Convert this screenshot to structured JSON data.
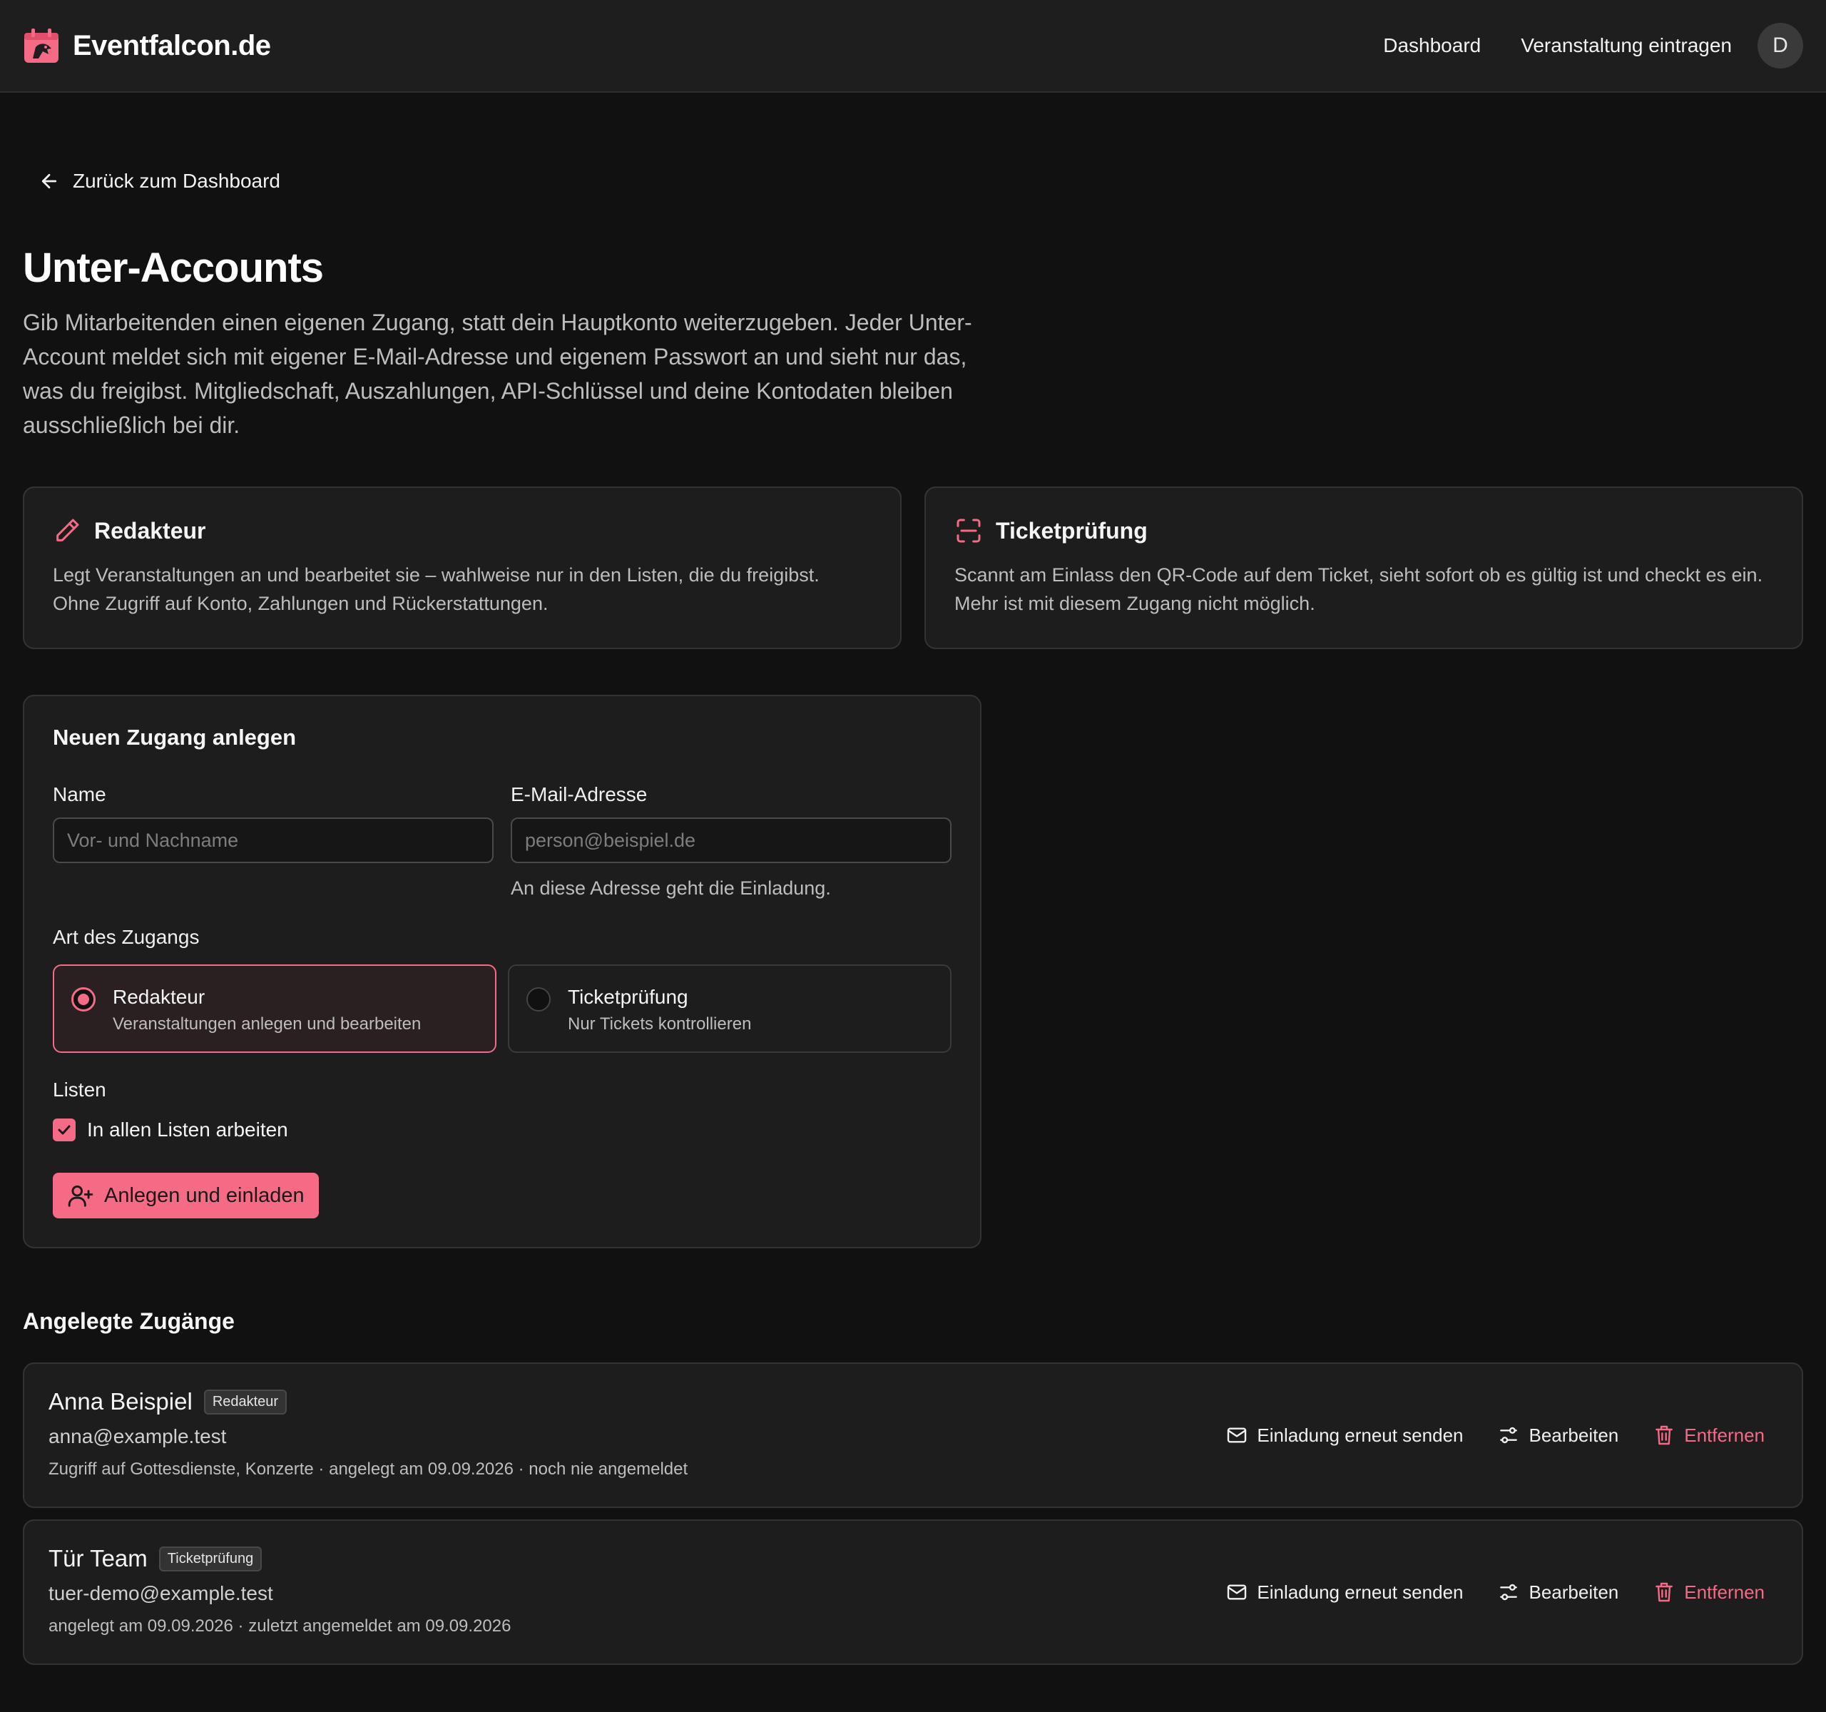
{
  "nav": {
    "brand": "Eventfalcon.de",
    "links": [
      "Dashboard",
      "Veranstaltung eintragen"
    ],
    "avatar_initial": "D"
  },
  "back_link": "Zurück zum Dashboard",
  "page": {
    "title": "Unter-Accounts",
    "description": "Gib Mitarbeitenden einen eigenen Zugang, statt dein Hauptkonto weiterzugeben. Jeder Unter-Account meldet sich mit eigener E-Mail-Adresse und eigenem Passwort an und sieht nur das, was du freigibst. Mitgliedschaft, Auszahlungen, API-Schlüssel und deine Kontodaten bleiben ausschließlich bei dir."
  },
  "roles": [
    {
      "icon": "pencil-icon",
      "title": "Redakteur",
      "text": "Legt Veranstaltungen an und bearbeitet sie – wahlweise nur in den Listen, die du freigibst. Ohne Zugriff auf Konto, Zahlungen und Rückerstattungen."
    },
    {
      "icon": "scan-icon",
      "title": "Ticketprüfung",
      "text": "Scannt am Einlass den QR-Code auf dem Ticket, sieht sofort ob es gültig ist und checkt es ein. Mehr ist mit diesem Zugang nicht möglich."
    }
  ],
  "form": {
    "title": "Neuen Zugang anlegen",
    "name_label": "Name",
    "name_placeholder": "Vor- und Nachname",
    "email_label": "E-Mail-Adresse",
    "email_placeholder": "person@beispiel.de",
    "email_hint": "An diese Adresse geht die Einladung.",
    "type_label": "Art des Zugangs",
    "options": [
      {
        "title": "Redakteur",
        "subtitle": "Veranstaltungen anlegen und bearbeiten",
        "selected": true
      },
      {
        "title": "Ticketprüfung",
        "subtitle": "Nur Tickets kontrollieren",
        "selected": false
      }
    ],
    "lists_label": "Listen",
    "all_lists_label": "In allen Listen arbeiten",
    "all_lists_checked": true,
    "submit_label": "Anlegen und einladen"
  },
  "accounts_section": {
    "title": "Angelegte Zugänge",
    "actions": {
      "resend": "Einladung erneut senden",
      "edit": "Bearbeiten",
      "remove": "Entfernen"
    },
    "accounts": [
      {
        "name": "Anna Beispiel",
        "role": "Redakteur",
        "email": "anna@example.test",
        "meta": "Zugriff auf Gottesdienste, Konzerte · angelegt am 09.09.2026 · noch nie angemeldet"
      },
      {
        "name": "Tür Team",
        "role": "Ticketprüfung",
        "email": "tuer-demo@example.test",
        "meta": "angelegt am 09.09.2026 · zuletzt angemeldet am 09.09.2026"
      }
    ]
  },
  "colors": {
    "accent": "#f56a84",
    "background": "#111111",
    "surface": "#1d1d1d",
    "border": "#333333"
  }
}
